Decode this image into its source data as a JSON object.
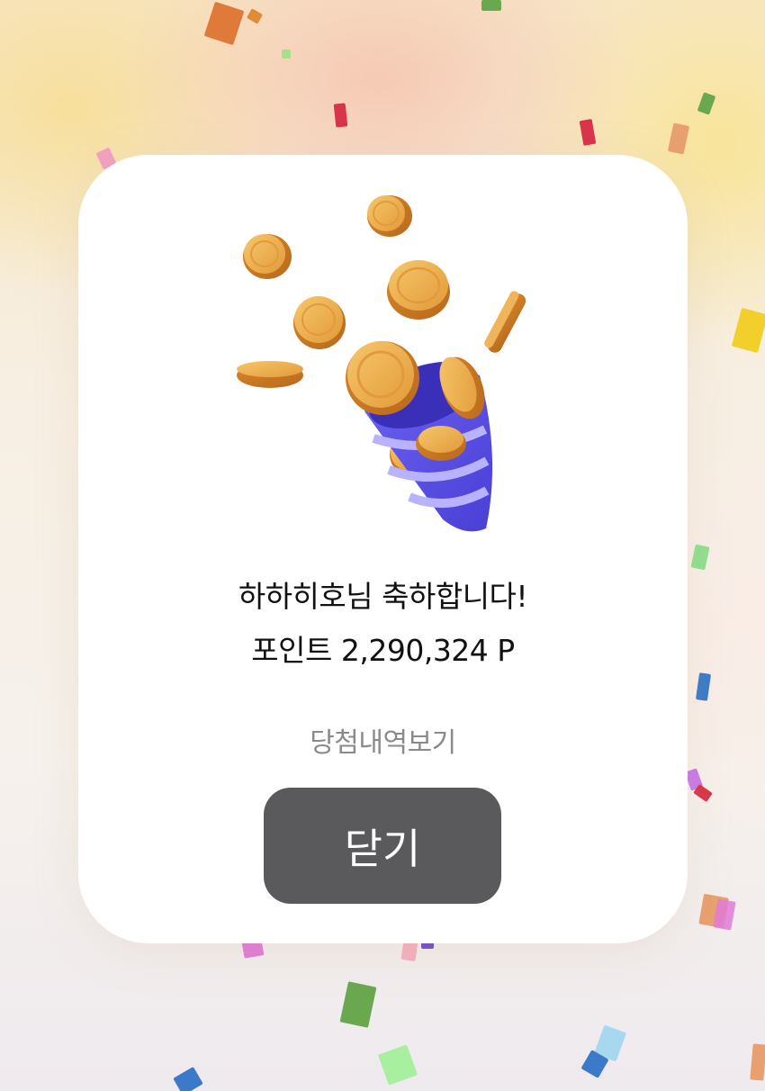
{
  "celebration": {
    "message": "하하히호님 축하합니다!",
    "points": "포인트 2,290,324 P"
  },
  "links": {
    "history": "당첨내역보기"
  },
  "buttons": {
    "close": "닫기"
  },
  "colors": {
    "close_button": "#5a595b",
    "coin": "#e9a94a",
    "cone": "#5a4fe0",
    "link_text": "#8a8a8a"
  }
}
